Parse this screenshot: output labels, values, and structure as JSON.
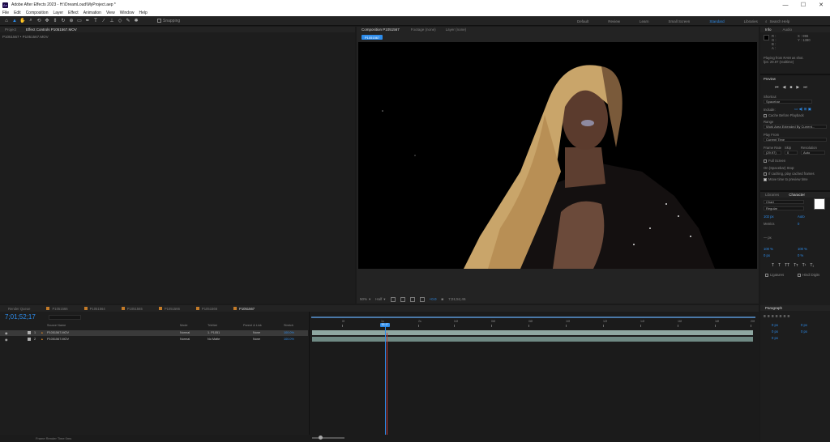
{
  "app": {
    "title": "Adobe After Effects 2023 - H:\\DreamLoud\\MyProject.aep *"
  },
  "window_controls": {
    "minimize": "—",
    "maximize": "☐",
    "close": "✕"
  },
  "menu": [
    "File",
    "Edit",
    "Composition",
    "Layer",
    "Effect",
    "Animation",
    "View",
    "Window",
    "Help"
  ],
  "toolbar": {
    "snapping_label": "Snapping"
  },
  "workspaces": [
    "Default",
    "Review",
    "Learn",
    "Small Screen",
    "Standard",
    "Libraries"
  ],
  "active_workspace": "Standard",
  "search": {
    "placeholder": "Search Help"
  },
  "left_panel": {
    "tabs": [
      "Project",
      "Effect Controls P1051567.MOV"
    ],
    "subtitle": "P1051567 • P1051567.MOV"
  },
  "comp_panel": {
    "tabs": [
      "Composition P1051567",
      "Footage (none)",
      "Layer (none)"
    ],
    "subject_tab": "P1051567",
    "footer": {
      "zoom": "50%",
      "resolution": "Half",
      "channel": "+0.0",
      "timecode": "7;01;51;45"
    }
  },
  "info_panel": {
    "tabs": [
      "Info",
      "Audio"
    ],
    "r": "R :",
    "g": "G :",
    "b": "B :",
    "a": "A :",
    "x": "X : 996",
    "y": "Y : 1380",
    "msg1": "Playing from RAM as shot.",
    "msg2": "fps: 29.97 (realtime)"
  },
  "preview_panel": {
    "title": "Preview",
    "shortcut_label": "Shortcut",
    "shortcut_value": "Spacebar",
    "include_label": "Include:",
    "cache_label": "Cache Before Playback",
    "range_label": "Range",
    "range_value": "Work Area Extended By Current...",
    "play_from_label": "Play From",
    "play_from_value": "Current Time",
    "frame_rate_label": "Frame Rate",
    "frame_rate_value": "(29.97)",
    "skip_label": "Skip",
    "skip_value": "0",
    "resolution_label": "Resolution",
    "resolution_value": "Auto",
    "full_screen_label": "Full Screen",
    "on_stop_label": "On (Spacebar) Stop:",
    "if_caching_label": "If caching, play cached frames",
    "move_time_label": "Move time to preview time"
  },
  "character_panel": {
    "tabs": [
      "Libraries",
      "Character"
    ],
    "font": "Chart",
    "style": "Regular",
    "size": "102 px",
    "leading": "Auto",
    "tracking": "Metrics",
    "kerning": "0",
    "stroke": "— px",
    "vscale": "100 %",
    "hscale": "100 %",
    "baseline": "0 px",
    "tsume": "0 %",
    "styles": [
      "T",
      "T",
      "TT",
      "Tт",
      "T¹",
      "T₁"
    ],
    "ligatures": "Ligatures",
    "hindi": "Hindi Digits"
  },
  "paragraph_panel": {
    "title": "Paragraph",
    "indent_left": "0 px",
    "indent_right": "0 px",
    "indent_first": "0 px",
    "space_before": "0 px",
    "space_after": "0 px"
  },
  "timeline": {
    "tabs": [
      "Render Queue",
      "P1051566",
      "P1051564",
      "P1051565",
      "P1051566",
      "P1051566",
      "P1051567"
    ],
    "active_tab": "P1051567",
    "timecode": "7;01;52;17",
    "header": {
      "source": "Source Name",
      "mode": "Mode",
      "trkmat": "TrkMat",
      "parent": "Parent & Link",
      "stretch": "Stretch"
    },
    "layers": [
      {
        "num": "1",
        "name": "P1051567.MOV",
        "mode": "Normal",
        "trkmat": "1. P1051",
        "parent": "None",
        "stretch": "100.0%"
      },
      {
        "num": "2",
        "name": "P1051567.MOV",
        "mode": "Normal",
        "trkmat": "No Matte",
        "parent": "None",
        "stretch": "100.0%"
      }
    ],
    "ruler": [
      "0f",
      "1s",
      "2s",
      "04f",
      "06f",
      "08f",
      "10f",
      "12f",
      "14f",
      "16f",
      "18f",
      "20f"
    ],
    "cti_label": "52;17",
    "footer": "Frame Render Time  0ms"
  },
  "colors": {
    "accent": "#2d8ceb",
    "layer_bar": "#8fa8a2",
    "cti_red": "#c23b3b"
  }
}
